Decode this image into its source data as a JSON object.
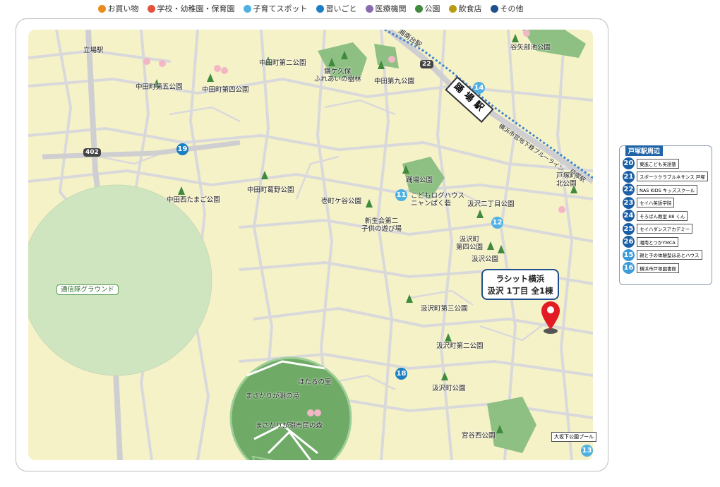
{
  "legend": [
    {
      "label": "お買い物",
      "color": "#e98b1d"
    },
    {
      "label": "学校・幼稚園・保育園",
      "color": "#e3523c"
    },
    {
      "label": "子育てスポット",
      "color": "#4fb0e3"
    },
    {
      "label": "習いごと",
      "color": "#1a7fc3"
    },
    {
      "label": "医療機関",
      "color": "#8a6bb0"
    },
    {
      "label": "公園",
      "color": "#3f8a3c"
    },
    {
      "label": "飲食店",
      "color": "#b99c12"
    },
    {
      "label": "その他",
      "color": "#1f4f8c"
    }
  ],
  "map": {
    "place_labels": {
      "tachiba_station": "立場駅",
      "nakata_5": "中田町第五公園",
      "nakata_4": "中田町第四公園",
      "nakata_2": "中田町第二公園",
      "kamakubo": "鎌ケ久保\nふれあいの樹林",
      "nakata_9": "中田第九公園",
      "yatobe": "谷矢部池公園",
      "nakatanishi": "中田西たまご公園",
      "nakata_kuzuno": "中田町葛野公園",
      "ichoukeya": "壱町ケ谷公園",
      "shinseikai": "新生会第二\n子供の遊び場",
      "odoriba_park": "踊場公園",
      "kodomo_log": "こどもログハウス\nニャンぱく砦",
      "namisawa_2": "汲沢二丁目公園",
      "namisawa_4": "汲沢町\n第四公園",
      "namisawa_park": "汲沢公園",
      "totsuka_kita": "戸塚町\n北公園",
      "tsushintai": "通信隊グラウンド",
      "namisawa_3": "汲沢町第三公園",
      "namisawa_2b": "汲沢町第二公園",
      "namisawa_town": "汲沢町公園",
      "miyaya_nishi": "宮谷西公園",
      "shonandai": "湘南台駅",
      "subway": "横浜市営地下鉄ブルーライン",
      "totsuka_arrow": "戸塚駅",
      "hotaru": "ほたるの里",
      "masakari_falls": "まさかりが淵の滝",
      "masakari_forest": "まさかりが淵市民の森",
      "pool": "大坂下公園プール"
    },
    "station_name": "踊場駅",
    "road_numbers": {
      "r402": "402",
      "r22": "22"
    },
    "spot_numbers": {
      "n19": "19",
      "n11": "11",
      "n12": "12",
      "n14": "14",
      "n18": "18",
      "n13": "13"
    },
    "property": {
      "line1": "ラシット横浜",
      "line2": "汲沢 1丁目 全1棟"
    }
  },
  "sidebar": {
    "title": "戸塚駅周辺",
    "items": [
      {
        "num": "20",
        "label": "東進こども英語塾"
      },
      {
        "num": "21",
        "label": "スポーツクラブルネサンス 戸塚"
      },
      {
        "num": "22",
        "label": "NAS KIDS キッズスクール"
      },
      {
        "num": "23",
        "label": "セイハ英語学院"
      },
      {
        "num": "24",
        "label": "そろばん教室 88 くん"
      },
      {
        "num": "25",
        "label": "セイハダンスアカデミー"
      },
      {
        "num": "26",
        "label": "湘南とつかYMCA"
      },
      {
        "num": "15",
        "label": "親と子の体験型ほあとハウス"
      },
      {
        "num": "16",
        "label": "横浜市戸塚図書館"
      }
    ]
  }
}
